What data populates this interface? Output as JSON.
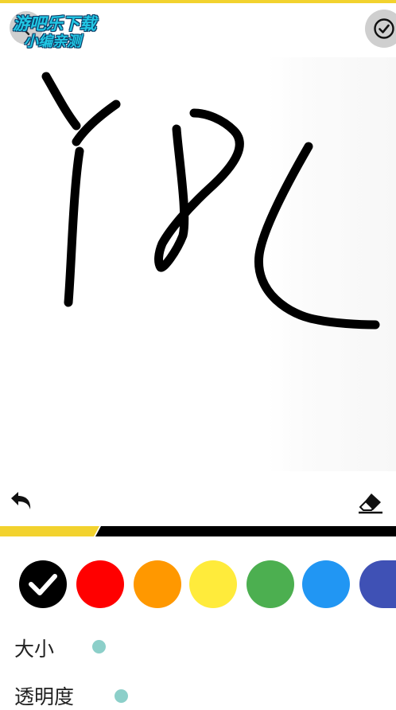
{
  "watermark": {
    "line1": "游吧乐下载",
    "line2": "小编亲测"
  },
  "toolbar": {
    "back_icon": "chevron-left-icon",
    "confirm_icon": "check-circle-icon",
    "undo_icon": "undo-icon",
    "eraser_icon": "eraser-icon"
  },
  "colors": {
    "accent": "#f2d22e",
    "palette": [
      {
        "name": "black",
        "hex": "#000000",
        "selected": true
      },
      {
        "name": "red",
        "hex": "#ff0000",
        "selected": false
      },
      {
        "name": "orange",
        "hex": "#ff9800",
        "selected": false
      },
      {
        "name": "yellow",
        "hex": "#ffeb3b",
        "selected": false
      },
      {
        "name": "green",
        "hex": "#4caf50",
        "selected": false
      },
      {
        "name": "blue",
        "hex": "#2196f3",
        "selected": false
      },
      {
        "name": "indigo",
        "hex": "#3f51b5",
        "selected": false
      }
    ]
  },
  "settings": {
    "size_label": "大小",
    "opacity_label": "透明度"
  }
}
